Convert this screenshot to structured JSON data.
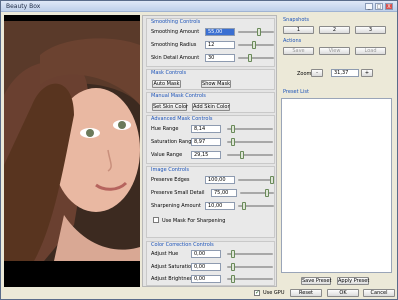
{
  "window": {
    "title": "Beauty Box",
    "minimize": "_",
    "maximize": "□",
    "close": "X"
  },
  "smoothing": {
    "title": "Smoothing Controls",
    "amount_label": "Smoothing Amount",
    "amount_value": "55,00",
    "radius_label": "Smoothing Radius",
    "radius_value": "12",
    "detail_label": "Skin Detail Amount",
    "detail_value": "30"
  },
  "mask": {
    "title": "Mask Controls",
    "auto_label": "Auto Mask",
    "show_label": "Show Mask"
  },
  "manual_mask": {
    "title": "Manual Mask Controls",
    "set_label": "Set Skin Color",
    "add_label": "Add Skin Color"
  },
  "advanced": {
    "title": "Advanced Mask Controls",
    "hue_label": "Hue Range",
    "hue_value": "8,14",
    "sat_label": "Saturation Range",
    "sat_value": "8,97",
    "val_label": "Value Range",
    "val_value": "29,15"
  },
  "image": {
    "title": "Image Controls",
    "edges_label": "Preserve Edges",
    "edges_value": "100,00",
    "small_label": "Preserve Small Detail",
    "small_value": "75,00",
    "sharp_label": "Sharpening Amount",
    "sharp_value": "10,00",
    "mask_sharp_label": "Use Mask For Sharpening"
  },
  "color": {
    "title": "Color Correction Controls",
    "hue_label": "Adjust Hue",
    "hue_value": "0,00",
    "sat_label": "Adjust Saturation",
    "sat_value": "0,00",
    "bri_label": "Adjust Brightness",
    "bri_value": "0,00"
  },
  "snapshots": {
    "title": "Snapshots",
    "b1": "1",
    "b2": "2",
    "b3": "3"
  },
  "actions": {
    "title": "Actions",
    "save": "Save",
    "view": "View",
    "load": "Load"
  },
  "zoom": {
    "label": "Zoom",
    "minus": "-",
    "value": "31,37",
    "plus": "+"
  },
  "presets": {
    "title": "Preset List",
    "save": "Save Preset",
    "apply": "Apply Preset"
  },
  "footer": {
    "use_gpu": "Use GPU",
    "reset": "Reset",
    "ok": "OK",
    "cancel": "Cancel"
  },
  "colors": {
    "accent": "#1b52b8",
    "selection": "#3a6fd2"
  }
}
